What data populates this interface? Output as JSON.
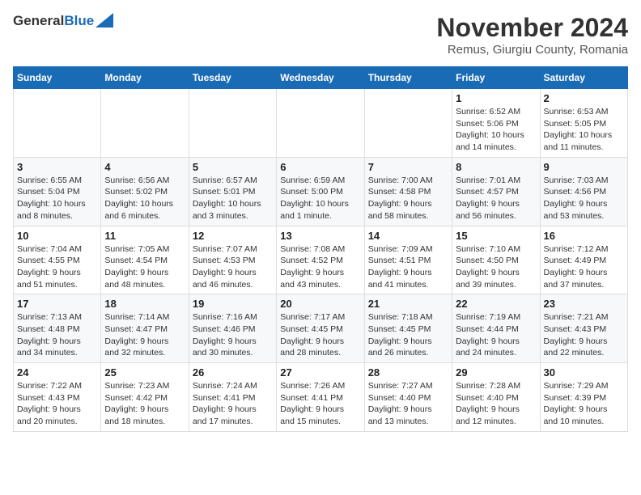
{
  "header": {
    "logo_general": "General",
    "logo_blue": "Blue",
    "month_title": "November 2024",
    "location": "Remus, Giurgiu County, Romania"
  },
  "weekdays": [
    "Sunday",
    "Monday",
    "Tuesday",
    "Wednesday",
    "Thursday",
    "Friday",
    "Saturday"
  ],
  "weeks": [
    [
      {
        "day": "",
        "info": ""
      },
      {
        "day": "",
        "info": ""
      },
      {
        "day": "",
        "info": ""
      },
      {
        "day": "",
        "info": ""
      },
      {
        "day": "",
        "info": ""
      },
      {
        "day": "1",
        "info": "Sunrise: 6:52 AM\nSunset: 5:06 PM\nDaylight: 10 hours\nand 14 minutes."
      },
      {
        "day": "2",
        "info": "Sunrise: 6:53 AM\nSunset: 5:05 PM\nDaylight: 10 hours\nand 11 minutes."
      }
    ],
    [
      {
        "day": "3",
        "info": "Sunrise: 6:55 AM\nSunset: 5:04 PM\nDaylight: 10 hours\nand 8 minutes."
      },
      {
        "day": "4",
        "info": "Sunrise: 6:56 AM\nSunset: 5:02 PM\nDaylight: 10 hours\nand 6 minutes."
      },
      {
        "day": "5",
        "info": "Sunrise: 6:57 AM\nSunset: 5:01 PM\nDaylight: 10 hours\nand 3 minutes."
      },
      {
        "day": "6",
        "info": "Sunrise: 6:59 AM\nSunset: 5:00 PM\nDaylight: 10 hours\nand 1 minute."
      },
      {
        "day": "7",
        "info": "Sunrise: 7:00 AM\nSunset: 4:58 PM\nDaylight: 9 hours\nand 58 minutes."
      },
      {
        "day": "8",
        "info": "Sunrise: 7:01 AM\nSunset: 4:57 PM\nDaylight: 9 hours\nand 56 minutes."
      },
      {
        "day": "9",
        "info": "Sunrise: 7:03 AM\nSunset: 4:56 PM\nDaylight: 9 hours\nand 53 minutes."
      }
    ],
    [
      {
        "day": "10",
        "info": "Sunrise: 7:04 AM\nSunset: 4:55 PM\nDaylight: 9 hours\nand 51 minutes."
      },
      {
        "day": "11",
        "info": "Sunrise: 7:05 AM\nSunset: 4:54 PM\nDaylight: 9 hours\nand 48 minutes."
      },
      {
        "day": "12",
        "info": "Sunrise: 7:07 AM\nSunset: 4:53 PM\nDaylight: 9 hours\nand 46 minutes."
      },
      {
        "day": "13",
        "info": "Sunrise: 7:08 AM\nSunset: 4:52 PM\nDaylight: 9 hours\nand 43 minutes."
      },
      {
        "day": "14",
        "info": "Sunrise: 7:09 AM\nSunset: 4:51 PM\nDaylight: 9 hours\nand 41 minutes."
      },
      {
        "day": "15",
        "info": "Sunrise: 7:10 AM\nSunset: 4:50 PM\nDaylight: 9 hours\nand 39 minutes."
      },
      {
        "day": "16",
        "info": "Sunrise: 7:12 AM\nSunset: 4:49 PM\nDaylight: 9 hours\nand 37 minutes."
      }
    ],
    [
      {
        "day": "17",
        "info": "Sunrise: 7:13 AM\nSunset: 4:48 PM\nDaylight: 9 hours\nand 34 minutes."
      },
      {
        "day": "18",
        "info": "Sunrise: 7:14 AM\nSunset: 4:47 PM\nDaylight: 9 hours\nand 32 minutes."
      },
      {
        "day": "19",
        "info": "Sunrise: 7:16 AM\nSunset: 4:46 PM\nDaylight: 9 hours\nand 30 minutes."
      },
      {
        "day": "20",
        "info": "Sunrise: 7:17 AM\nSunset: 4:45 PM\nDaylight: 9 hours\nand 28 minutes."
      },
      {
        "day": "21",
        "info": "Sunrise: 7:18 AM\nSunset: 4:45 PM\nDaylight: 9 hours\nand 26 minutes."
      },
      {
        "day": "22",
        "info": "Sunrise: 7:19 AM\nSunset: 4:44 PM\nDaylight: 9 hours\nand 24 minutes."
      },
      {
        "day": "23",
        "info": "Sunrise: 7:21 AM\nSunset: 4:43 PM\nDaylight: 9 hours\nand 22 minutes."
      }
    ],
    [
      {
        "day": "24",
        "info": "Sunrise: 7:22 AM\nSunset: 4:43 PM\nDaylight: 9 hours\nand 20 minutes."
      },
      {
        "day": "25",
        "info": "Sunrise: 7:23 AM\nSunset: 4:42 PM\nDaylight: 9 hours\nand 18 minutes."
      },
      {
        "day": "26",
        "info": "Sunrise: 7:24 AM\nSunset: 4:41 PM\nDaylight: 9 hours\nand 17 minutes."
      },
      {
        "day": "27",
        "info": "Sunrise: 7:26 AM\nSunset: 4:41 PM\nDaylight: 9 hours\nand 15 minutes."
      },
      {
        "day": "28",
        "info": "Sunrise: 7:27 AM\nSunset: 4:40 PM\nDaylight: 9 hours\nand 13 minutes."
      },
      {
        "day": "29",
        "info": "Sunrise: 7:28 AM\nSunset: 4:40 PM\nDaylight: 9 hours\nand 12 minutes."
      },
      {
        "day": "30",
        "info": "Sunrise: 7:29 AM\nSunset: 4:39 PM\nDaylight: 9 hours\nand 10 minutes."
      }
    ]
  ]
}
